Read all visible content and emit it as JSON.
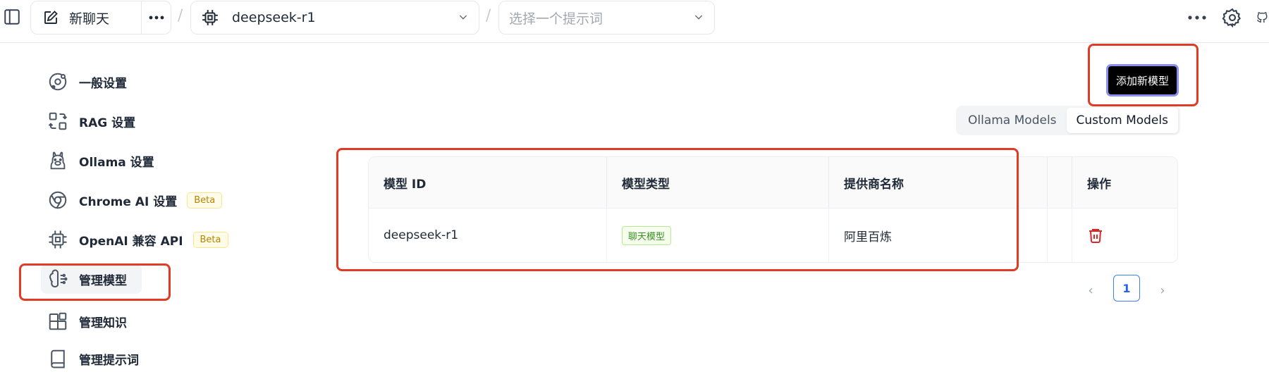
{
  "topbar": {
    "new_chat_label": "新聊天",
    "model_select_value": "deepseek-r1",
    "prompt_select_placeholder": "选择一个提示词"
  },
  "sidebar": {
    "items": [
      {
        "label": "一般设置",
        "icon": "general-settings-icon"
      },
      {
        "label": "RAG 设置",
        "icon": "rag-icon"
      },
      {
        "label": "Ollama 设置",
        "icon": "ollama-icon"
      },
      {
        "label": "Chrome AI 设置",
        "icon": "chrome-icon",
        "badge": "Beta"
      },
      {
        "label": "OpenAI 兼容 API",
        "icon": "chip-icon",
        "badge": "Beta"
      },
      {
        "label": "管理模型",
        "icon": "brain-icon",
        "active": true
      },
      {
        "label": "管理知识",
        "icon": "blocks-icon"
      },
      {
        "label": "管理提示词",
        "icon": "book-icon"
      }
    ]
  },
  "main": {
    "add_model_button": "添加新模型",
    "tabs": [
      {
        "label": "Ollama Models",
        "selected": false
      },
      {
        "label": "Custom Models",
        "selected": true
      }
    ],
    "table": {
      "columns": [
        "模型 ID",
        "模型类型",
        "提供商名称",
        "操作"
      ],
      "rows": [
        {
          "model_id": "deepseek-r1",
          "model_type": "聊天模型",
          "provider": "阿里百炼",
          "action_icon": "trash-icon"
        }
      ]
    },
    "pagination": {
      "current_page": "1",
      "prev": "‹",
      "next": "›"
    }
  },
  "colors": {
    "annotation_red": "#e03b24",
    "primary_button": "#000000",
    "tag_green": "#3f8f2a",
    "delete_red": "#dc2626",
    "page_blue": "#2563eb"
  }
}
